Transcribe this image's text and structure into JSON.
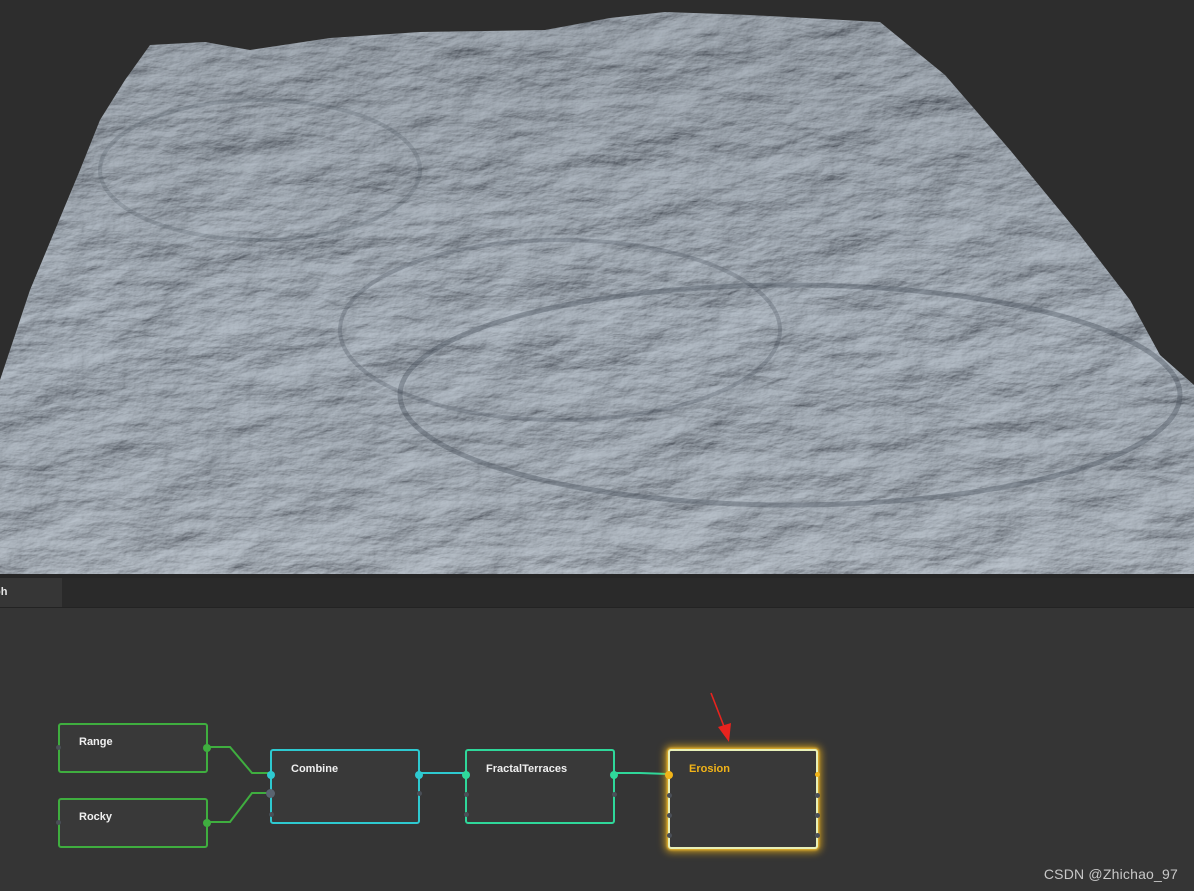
{
  "viewport": {
    "content": "3D terrain preview"
  },
  "tabs": {
    "graph": "ph"
  },
  "nodes": [
    {
      "id": "range",
      "title": "Range",
      "color": "#3fae3f"
    },
    {
      "id": "rocky",
      "title": "Rocky",
      "color": "#3fae3f"
    },
    {
      "id": "combine",
      "title": "Combine",
      "color": "#2ec9d0"
    },
    {
      "id": "fractal",
      "title": "FractalTerraces",
      "color": "#2fd79a"
    },
    {
      "id": "erosion",
      "title": "Erosion",
      "color": "#f2b418"
    }
  ],
  "annotation": {
    "arrow_color": "#e8231e"
  },
  "watermark": "CSDN @Zhichao_97"
}
